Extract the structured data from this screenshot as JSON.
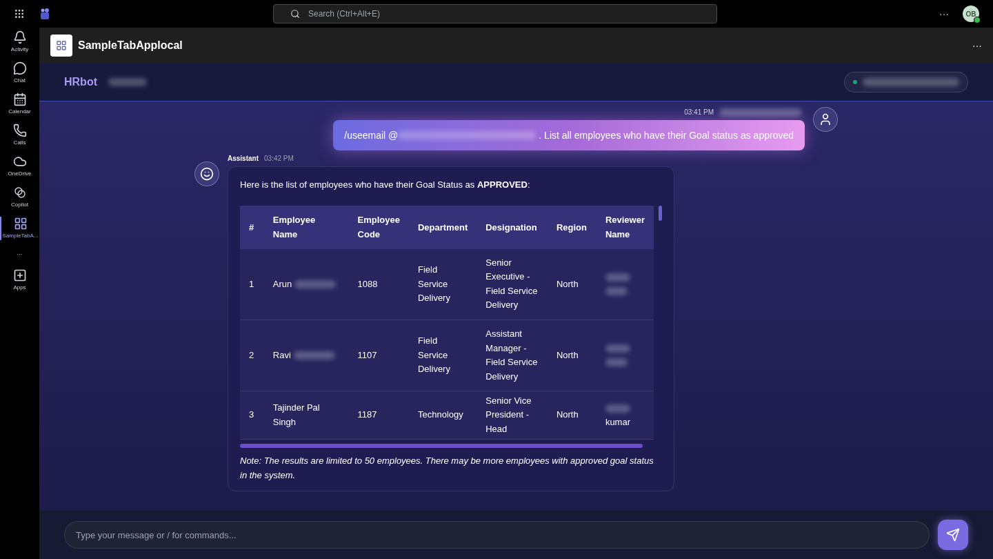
{
  "top_bar": {
    "search": {
      "placeholder": "Search (Ctrl+Alt+E)"
    },
    "more": "···",
    "avatar": {
      "initials": "OB",
      "online": true
    }
  },
  "rail": {
    "items": [
      {
        "kind": "bell",
        "label": "Activity",
        "selected": false
      },
      {
        "kind": "chat",
        "label": "Chat",
        "selected": false
      },
      {
        "kind": "calendar",
        "label": "Calendar",
        "selected": false
      },
      {
        "kind": "phone",
        "label": "Calls",
        "selected": false
      },
      {
        "kind": "cloud",
        "label": "OneDrive",
        "selected": false
      },
      {
        "kind": "copilot",
        "label": "Copilot",
        "selected": false
      },
      {
        "kind": "apps",
        "label": "SampleTabA...",
        "selected": true
      },
      {
        "kind": "more",
        "label": "···",
        "selected": false
      },
      {
        "kind": "add",
        "label": "Apps",
        "selected": false
      }
    ]
  },
  "app_header": {
    "title": "SampleTabApplocal",
    "more": "···"
  },
  "bot_header": {
    "name": "HRbot",
    "badge_redacted": true,
    "account_redacted": true,
    "account_online": true
  },
  "messages": [
    {
      "kind": "user",
      "time": "03:41 PM",
      "sender_redacted": true,
      "command": "/useemail @",
      "text": ". List all employees who have their Goal status as approved"
    },
    {
      "kind": "assistant",
      "sender": "Assistant",
      "time": "03:42 PM",
      "intro": "Here is the list of employees who have their Goal Status as **APPROVED**:",
      "table": {
        "columns": [
          "#",
          "Employee Name",
          "Employee Code",
          "Department",
          "Designation",
          "Region",
          "Reviewer Name"
        ],
        "rows": [
          {
            "cells": [
              "1",
              "Arun",
              "1088",
              "Field Service Delivery",
              "Senior Executive - Field Service Delivery",
              "North",
              ""
            ],
            "name_redacted": true,
            "reviewer_redacted": true
          },
          {
            "cells": [
              "2",
              "Ravi",
              "1107",
              "Field Service Delivery",
              "Assistant Manager - Field Service Delivery",
              "North",
              ""
            ],
            "name_redacted": true,
            "reviewer_redacted": true
          },
          {
            "cells": [
              "3",
              "Tajinder Pal Singh",
              "1187",
              "Technology",
              "Senior Vice President - Head",
              "North",
              "kumar"
            ],
            "name_redacted": false,
            "reviewer_redacted": true
          }
        ]
      },
      "note": "Note: The results are limited to 50 employees. There may be more employees with approved goal status in the system."
    }
  ],
  "composer": {
    "placeholder": "Type your message or / for commands..."
  }
}
